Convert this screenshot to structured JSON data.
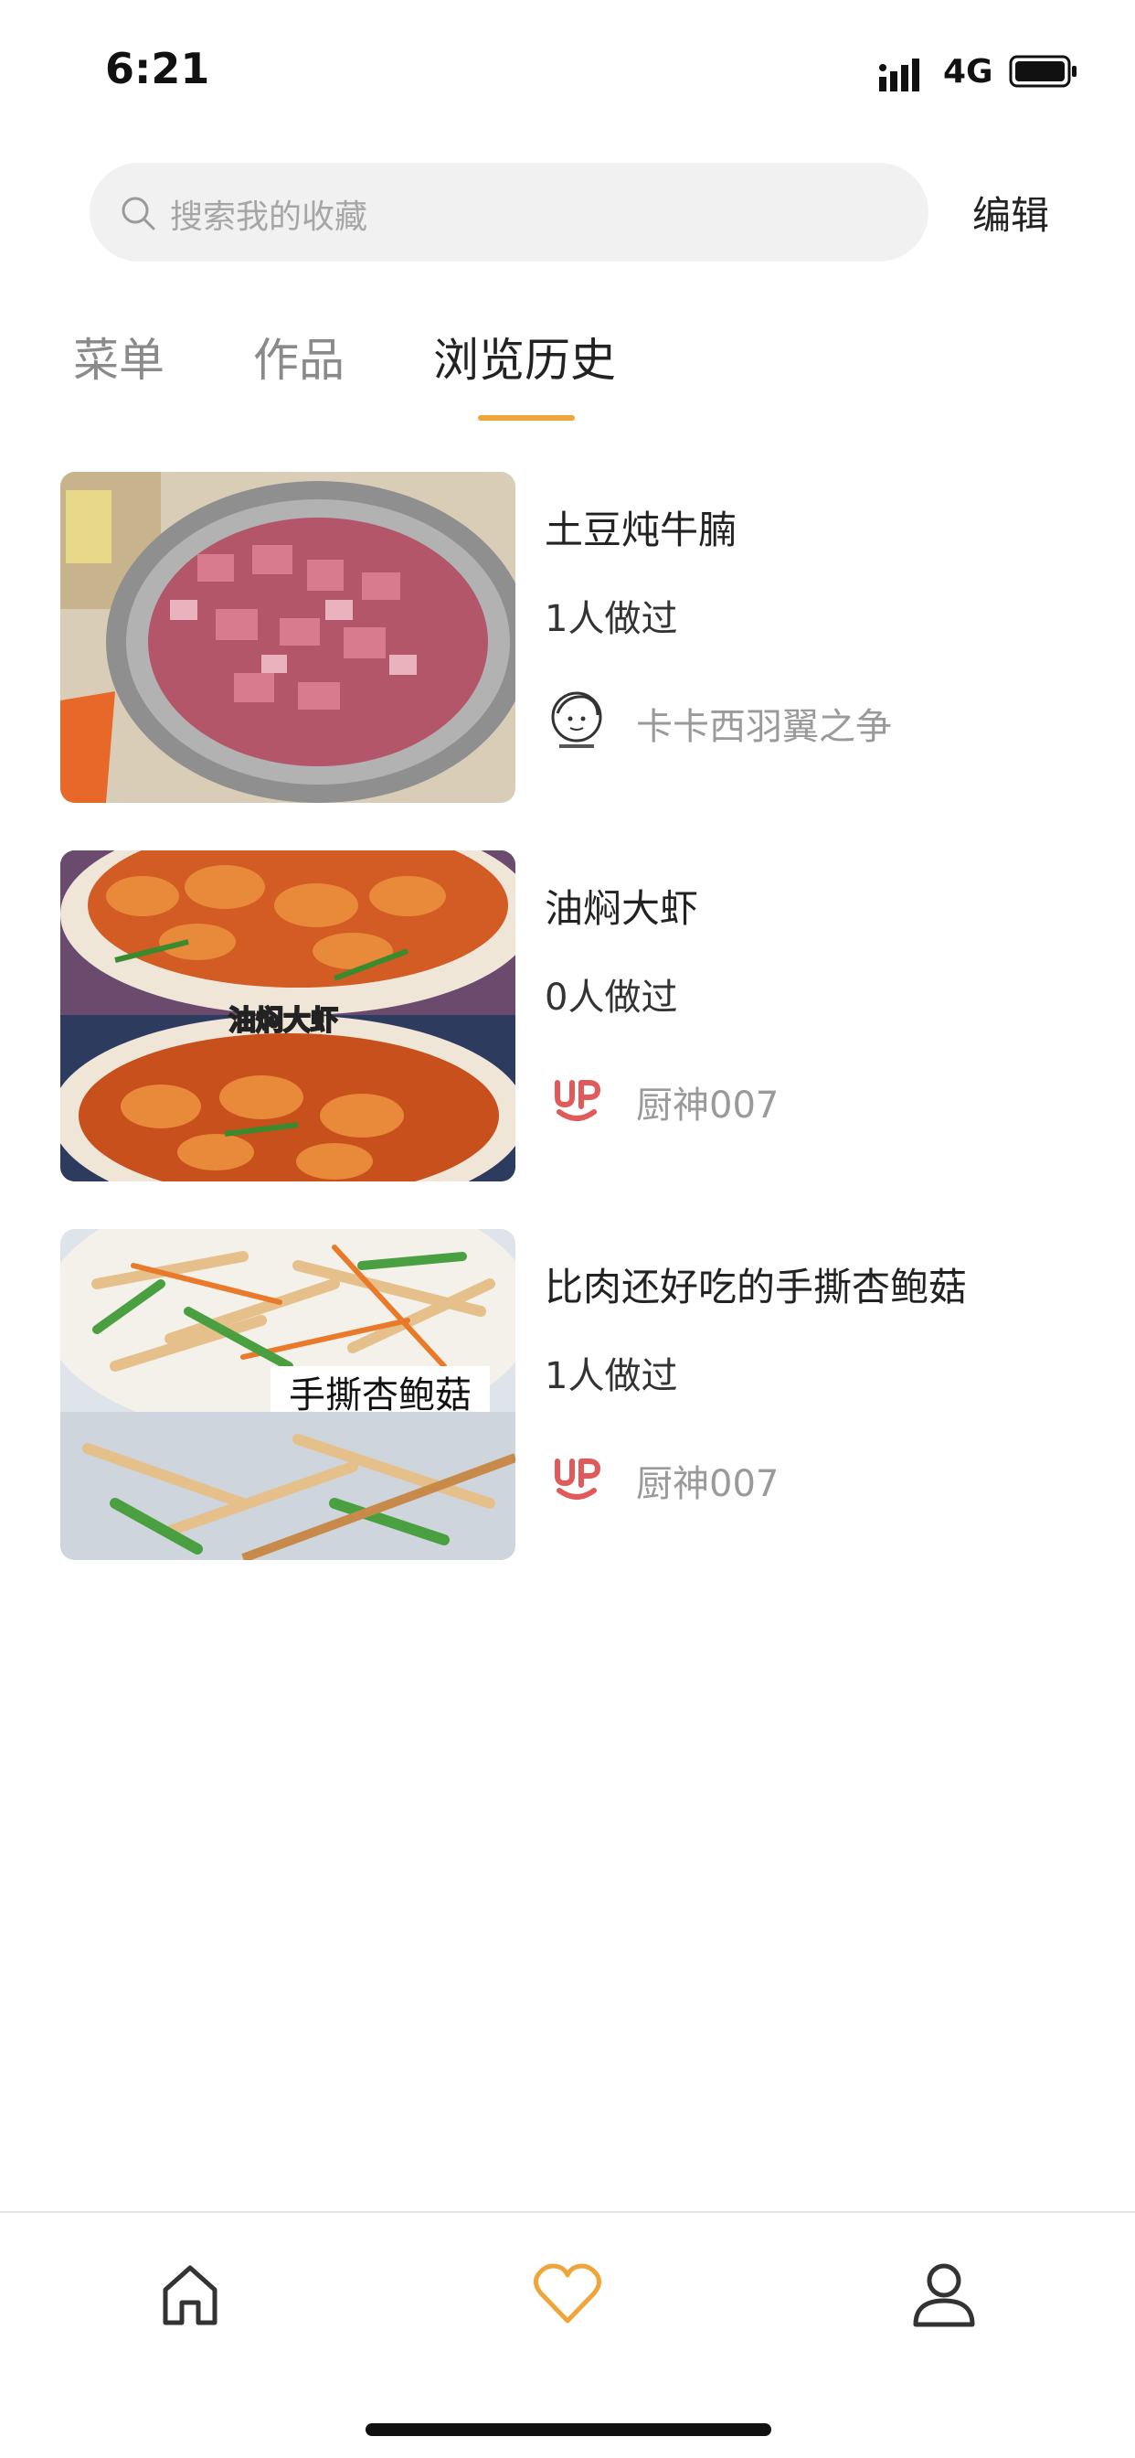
{
  "status_bar": {
    "time": "6:21",
    "network": "4G",
    "icons": [
      "signal-icon",
      "battery-icon"
    ]
  },
  "search": {
    "placeholder": "搜索我的收藏",
    "edit_label": "编辑"
  },
  "tabs": [
    {
      "label": "菜单",
      "active": false
    },
    {
      "label": "作品",
      "active": false
    },
    {
      "label": "浏览历史",
      "active": true
    }
  ],
  "recipes": [
    {
      "title": "土豆炖牛腩",
      "count": "1人做过",
      "author": "卡卡西羽翼之争",
      "author_avatar": "sketch-avatar"
    },
    {
      "title": "油焖大虾",
      "count": "0人做过",
      "author": "厨神007",
      "author_avatar": "brand-logo-avatar",
      "thumb_caption": "油焖大虾"
    },
    {
      "title": "比肉还好吃的手撕杏鲍菇",
      "count": "1人做过",
      "author": "厨神007",
      "author_avatar": "brand-logo-avatar",
      "thumb_caption": "手撕杏鲍菇"
    }
  ],
  "bottom_nav": [
    {
      "icon": "home-icon",
      "active": false
    },
    {
      "icon": "heart-icon",
      "active": true
    },
    {
      "icon": "user-icon",
      "active": false
    }
  ],
  "colors": {
    "accent": "#f0a53a",
    "logo_red": "#e05a5a",
    "search_bg": "#f1f1f1"
  }
}
